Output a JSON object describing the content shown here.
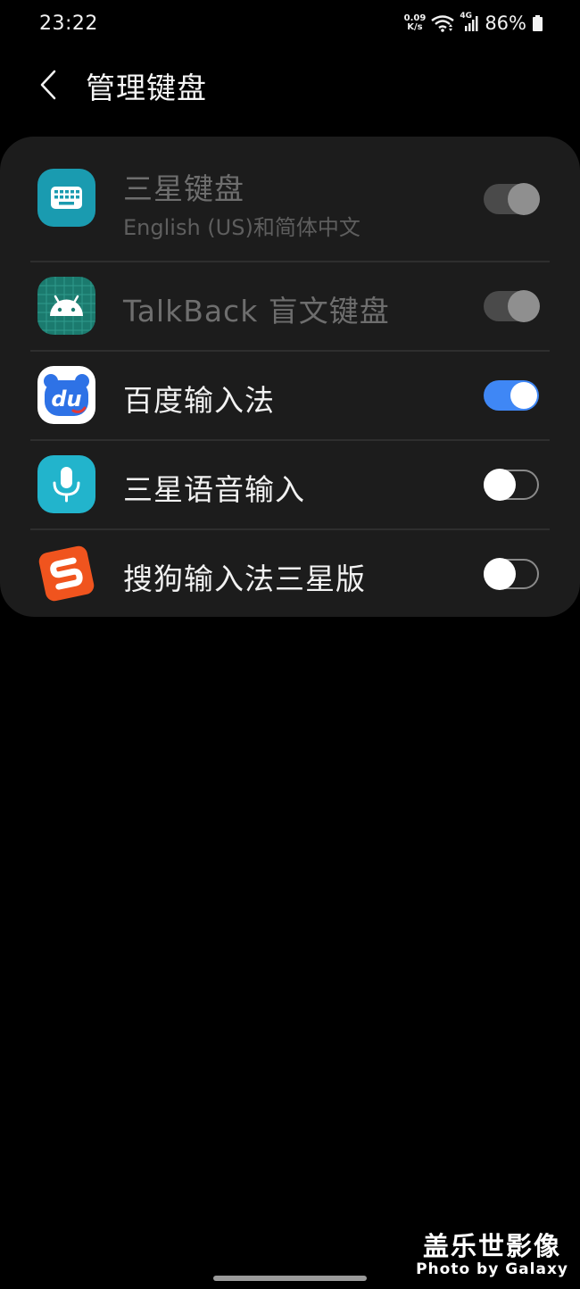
{
  "status_bar": {
    "time": "23:22",
    "net_speed_value": "0.09",
    "net_speed_unit": "K/s",
    "network_type": "4G",
    "battery_percent": "86%",
    "icons": [
      "wifi-icon",
      "cellular-signal-icon",
      "battery-icon"
    ]
  },
  "header": {
    "title": "管理键盘",
    "back_icon": "chevron-left-icon"
  },
  "keyboards": [
    {
      "name": "三星键盘",
      "subtitle": "English (US)和简体中文",
      "icon": "samsung-keyboard-icon",
      "icon_color": "#1a9bb0",
      "toggle": "on",
      "enabled": false
    },
    {
      "name": "TalkBack 盲文键盘",
      "icon": "android-braille-icon",
      "icon_color": "#1b7a6e",
      "toggle": "on",
      "enabled": false
    },
    {
      "name": "百度输入法",
      "icon": "baidu-du-icon",
      "icon_color": "#2e72e6",
      "toggle": "on",
      "enabled": true
    },
    {
      "name": "三星语音输入",
      "icon": "microphone-icon",
      "icon_color": "#22b4cc",
      "toggle": "off",
      "enabled": true
    },
    {
      "name": "搜狗输入法三星版",
      "icon": "sogou-s-icon",
      "icon_color": "#f0541e",
      "toggle": "off",
      "enabled": true
    }
  ],
  "watermark": {
    "line1": "盖乐世影像",
    "line2": "Photo by Galaxy"
  },
  "colors": {
    "background": "#000000",
    "card": "#1c1c1c",
    "accent": "#3f87f5"
  }
}
